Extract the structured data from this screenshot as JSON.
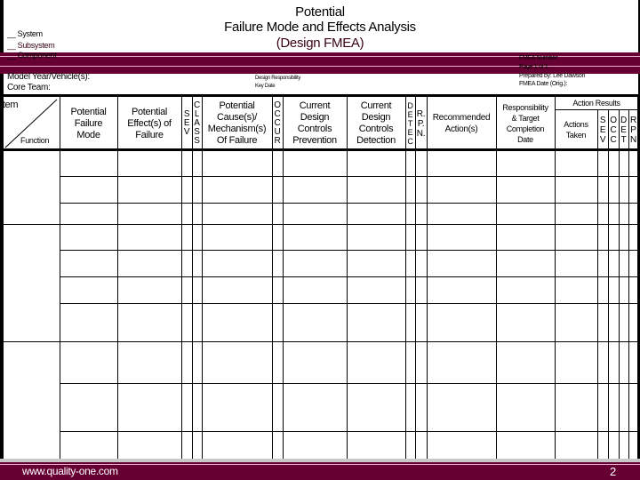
{
  "title": {
    "line1": "Potential",
    "line2": "Failure Mode and Effects Analysis",
    "line3": "(Design FMEA)"
  },
  "scope": {
    "system": "__ System",
    "subsystem": "__ Subsystem",
    "component": "__ Component"
  },
  "info": {
    "model_year": "Model Year/Vehicle(s):",
    "core_team": "Core Team:",
    "design_responsibility": "Design Responsibility",
    "key_date": "Key Date",
    "fmea_number": "FMEA Number:",
    "page": "Page 1 of 1",
    "prepared_by": "Prepared by: Lee Dawson",
    "fmea_date": "FMEA Date (Orig.):"
  },
  "columns": {
    "item": "Item",
    "function": "Function",
    "failure_mode": "Potential\nFailure\nMode",
    "effects": "Potential\nEffect(s) of\nFailure",
    "sev": "S\nE\nV",
    "class": "C\nL\nA\nS\nS",
    "causes": "Potential\nCause(s)/\nMechanism(s)\nOf Failure",
    "occur": "O\nC\nC\nU\nR",
    "prevention": "Current\nDesign\nControls\nPrevention",
    "detection": "Current\nDesign\nControls\nDetection",
    "detec": "D\nE\nT\nE\nC",
    "rpn": "R.\nP.\nN.",
    "recommended": "Recommended\nAction(s)",
    "responsibility": "Responsibility\n& Target\nCompletion\nDate",
    "action_results": "Action Results",
    "actions_taken": "Actions\nTaken",
    "r_sev": "S\nE\nV",
    "r_occ": "O\nC\nC",
    "r_det": "D\nE\nT",
    "r_rpn": "R\nP\nN"
  },
  "footer": {
    "url": "www.quality-one.com",
    "page_number": "2"
  },
  "colors": {
    "band": "#660033",
    "band_line": "#e8b0c8"
  }
}
